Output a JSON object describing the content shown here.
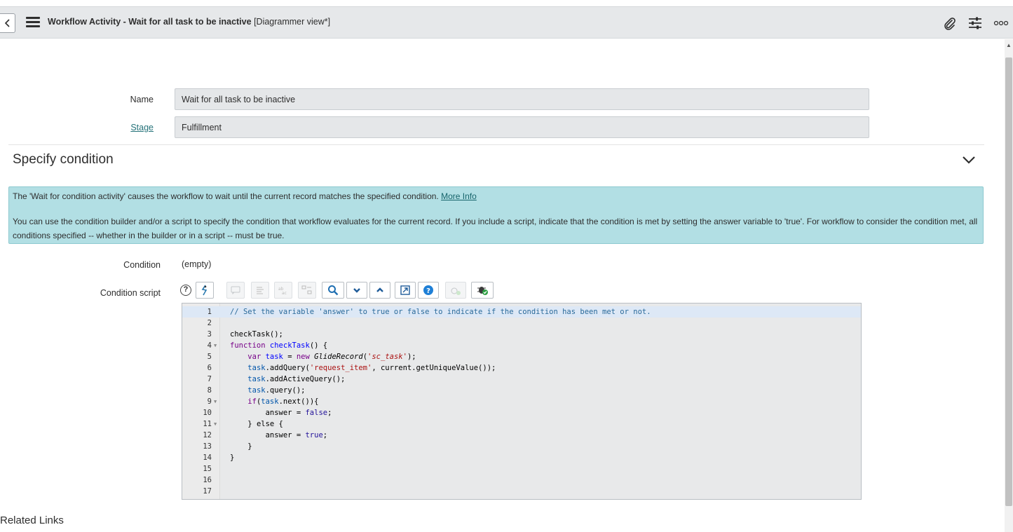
{
  "header": {
    "title_main": "Workflow Activity - Wait for all task to be inactive",
    "title_view": "[Diagrammer view*]",
    "icons": [
      "back-icon",
      "menu-icon",
      "attachment-icon",
      "settings-sliders-icon",
      "more-options-icon"
    ]
  },
  "form": {
    "name_label": "Name",
    "name_value": "Wait for all task to be inactive",
    "stage_label": "Stage",
    "stage_value": "Fulfillment"
  },
  "section": {
    "title": "Specify condition"
  },
  "info": {
    "line1": "The 'Wait for condition activity' causes the workflow to wait until the current record matches the specified condition.",
    "more_info": "More Info",
    "line2": "You can use the condition builder and/or a script to specify the condition that workflow evaluates for the current record. If you include a script, indicate that the condition is met by setting the answer variable to 'true'. For workflow to consider the condition met, all conditions specified -- whether in the builder or in a script -- must be true.",
    "background": "#b2dfe4"
  },
  "condition": {
    "label": "Condition",
    "value": "(empty)"
  },
  "script": {
    "label": "Condition script",
    "help_glyph": "?",
    "toolbar_icons": [
      "script-include-icon",
      "comment-icon",
      "format-icon",
      "replace-icon",
      "replace-all-icon",
      "search-icon",
      "chevron-down-icon",
      "chevron-up-icon",
      "fullscreen-icon",
      "help-icon",
      "debug-disabled-icon",
      "debug-icon"
    ],
    "line_numbers": [
      "1",
      "2",
      "3",
      "4",
      "5",
      "6",
      "7",
      "8",
      "9",
      "10",
      "11",
      "12",
      "13",
      "14",
      "15",
      "16",
      "17"
    ],
    "lines": {
      "l1": "// Set the variable 'answer' to true or false to indicate if the condition has been met or not.",
      "l3": "checkTask();",
      "l4a": "function",
      "l4b": "checkTask",
      "l4c": "() {",
      "l5a": "var",
      "l5b": "task",
      "l5c": " = ",
      "l5d": "new",
      "l5e": "GlideRecord",
      "l5f": "(",
      "l5g": "'sc_task'",
      "l5h": ");",
      "l6a": "task",
      "l6b": ".addQuery(",
      "l6c": "'request_item'",
      "l6d": ", current.getUniqueValue());",
      "l7a": "task",
      "l7b": ".addActiveQuery();",
      "l8a": "task",
      "l8b": ".query();",
      "l9a": "if",
      "l9b": "(",
      "l9c": "task",
      "l9d": ".next()){",
      "l10a": "answer = ",
      "l10b": "false",
      "l10c": ";",
      "l11": "} else {",
      "l12a": "answer = ",
      "l12b": "true",
      "l12c": ";",
      "l13": "}",
      "l14": "}"
    }
  },
  "related_links": "Related Links"
}
